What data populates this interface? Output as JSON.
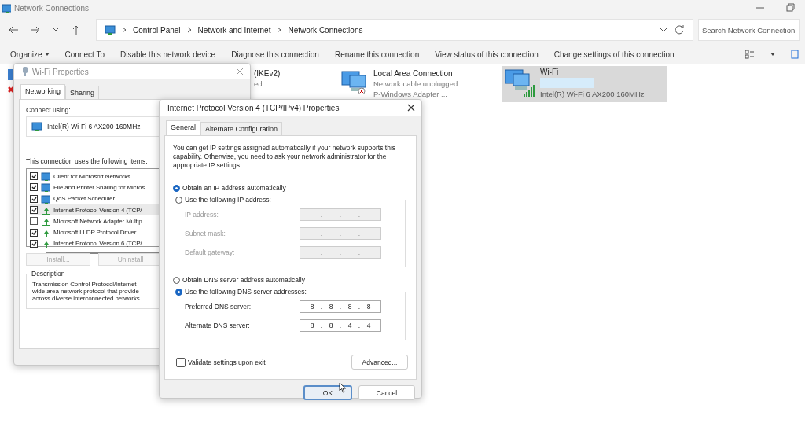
{
  "window": {
    "title": "Network Connections"
  },
  "address_bar": {
    "path": [
      "Control Panel",
      "Network and Internet",
      "Network Connections"
    ]
  },
  "search": {
    "placeholder": "Search Network Connection"
  },
  "toolbar": [
    {
      "label": "Organize",
      "kind": "menu"
    },
    {
      "label": "Connect To",
      "kind": "command"
    },
    {
      "label": "Disable this network device",
      "kind": "command"
    },
    {
      "label": "Diagnose this connection",
      "kind": "command"
    },
    {
      "label": "Rename this connection",
      "kind": "command"
    },
    {
      "label": "View status of this connection",
      "kind": "command"
    },
    {
      "label": "Change settings of this connection",
      "kind": "command"
    }
  ],
  "connections": [
    {
      "name": "(IKEv2)",
      "status": "ed",
      "selected": false,
      "kind": "partial"
    },
    {
      "name": "Local Area Connection",
      "status": "Network cable unplugged",
      "device": "P-Windows Adapter ...",
      "selected": false,
      "kind": "wired"
    },
    {
      "name": "Wi-Fi",
      "device": "Intel(R) Wi-Fi 6 AX200 160MHz",
      "selected": true,
      "kind": "wireless"
    }
  ],
  "wifi_properties": {
    "title": "Wi-Fi Properties",
    "tabs": [
      {
        "label": "Networking",
        "selected": true
      },
      {
        "label": "Sharing",
        "selected": false
      }
    ],
    "connect_using_label": "Connect using:",
    "adapter": "Intel(R) Wi-Fi 6 AX200 160MHz",
    "items_label": "This connection uses the following items:",
    "items": [
      {
        "label": "Client for Microsoft Networks",
        "checked": true,
        "selected": false,
        "kind": "client"
      },
      {
        "label": "File and Printer Sharing for Micros",
        "checked": true,
        "selected": false,
        "kind": "client"
      },
      {
        "label": "QoS Packet Scheduler",
        "checked": true,
        "selected": false,
        "kind": "client"
      },
      {
        "label": "Internet Protocol Version 4 (TCP/",
        "checked": true,
        "selected": true,
        "kind": "protocol"
      },
      {
        "label": "Microsoft Network Adapter Multip",
        "checked": false,
        "selected": false,
        "kind": "protocol"
      },
      {
        "label": "Microsoft LLDP Protocol Driver",
        "checked": true,
        "selected": false,
        "kind": "protocol"
      },
      {
        "label": "Internet Protocol Version 6 (TCP/",
        "checked": true,
        "selected": false,
        "kind": "protocol"
      }
    ],
    "buttons": [
      {
        "label": "Install...",
        "disabled": true
      },
      {
        "label": "Uninstall",
        "disabled": true
      }
    ],
    "description_label": "Description",
    "description_lines": [
      "Transmission Control Protocol/Internet",
      "wide area network protocol that provide",
      "across diverse interconnected networks"
    ]
  },
  "ipv4_properties": {
    "title": "Internet Protocol Version 4 (TCP/IPv4) Properties",
    "tabs": [
      {
        "label": "General",
        "selected": true
      },
      {
        "label": "Alternate Configuration",
        "selected": false
      }
    ],
    "intro": "You can get IP settings assigned automatically if your network supports this capability. Otherwise, you need to ask your network administrator for the appropriate IP settings.",
    "separator": ".",
    "ip_options": [
      {
        "label": "Obtain an IP address automatically",
        "selected": true
      },
      {
        "label": "Use the following IP address:",
        "selected": false
      }
    ],
    "ip_fields": [
      {
        "label": "IP address:",
        "disabled": true
      },
      {
        "label": "Subnet mask:",
        "disabled": true
      },
      {
        "label": "Default gateway:",
        "disabled": true
      }
    ],
    "dns_options": [
      {
        "label": "Obtain DNS server address automatically",
        "selected": false
      },
      {
        "label": "Use the following DNS server addresses:",
        "selected": true
      }
    ],
    "dns_fields": [
      {
        "label": "Preferred DNS server:",
        "disabled": false,
        "octets": [
          "8",
          "8",
          "8",
          "8"
        ]
      },
      {
        "label": "Alternate DNS server:",
        "disabled": false,
        "octets": [
          "8",
          "8",
          "4",
          "4"
        ]
      }
    ],
    "validate": {
      "label": "Validate settings upon exit",
      "checked": false
    },
    "advanced_button": "Advanced...",
    "ok_button": "OK",
    "cancel_button": "Cancel"
  }
}
